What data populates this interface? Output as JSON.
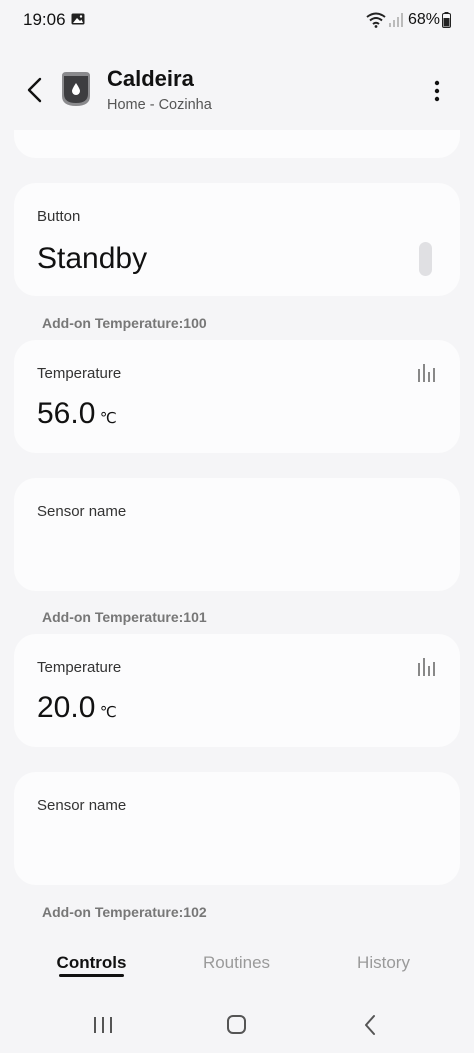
{
  "status_bar": {
    "time": "19:06",
    "battery": "68%"
  },
  "header": {
    "title": "Caldeira",
    "subtitle": "Home - Cozinha"
  },
  "button_card": {
    "label": "Button",
    "value": "Standby"
  },
  "sections": [
    {
      "label": "Add-on Temperature:100",
      "temperature_label": "Temperature",
      "temperature_value": "56.0",
      "unit": "℃",
      "sensor_label": "Sensor name"
    },
    {
      "label": "Add-on Temperature:101",
      "temperature_label": "Temperature",
      "temperature_value": "20.0",
      "unit": "℃",
      "sensor_label": "Sensor name"
    },
    {
      "label": "Add-on Temperature:102"
    }
  ],
  "tabs": [
    {
      "label": "Controls",
      "active": true
    },
    {
      "label": "Routines",
      "active": false
    },
    {
      "label": "History",
      "active": false
    }
  ],
  "colors": {
    "background": "#f5f5f7",
    "card": "#fcfcfd",
    "text_primary": "#111111",
    "text_muted": "#777777"
  }
}
